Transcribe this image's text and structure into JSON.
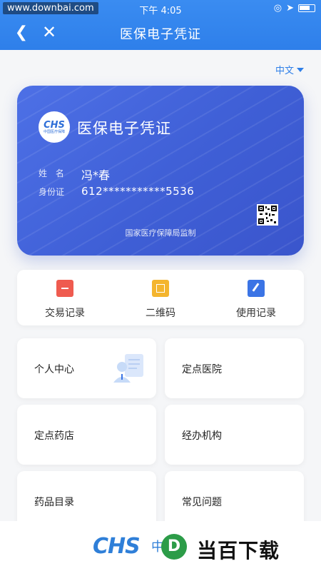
{
  "status_bar": {
    "watermark": "www.downbai.com",
    "time": "下午 4:05"
  },
  "nav": {
    "title": "医保电子凭证",
    "back_icon": "chevron-left-icon",
    "close_icon": "close-icon"
  },
  "language": {
    "selected": "中文"
  },
  "card": {
    "logo_text": "CHS",
    "logo_sub": "中国医疗保障",
    "title": "医保电子凭证",
    "name_label": "姓 名",
    "name_value": "冯*春",
    "id_label": "身份证",
    "id_value": "612***********5536",
    "supervisor": "国家医疗保障局监制"
  },
  "actions": [
    {
      "label": "交易记录",
      "icon": "document-icon",
      "color": "#ef5b4f"
    },
    {
      "label": "二维码",
      "icon": "qrcode-icon",
      "color": "#f4b52e"
    },
    {
      "label": "使用记录",
      "icon": "edit-icon",
      "color": "#3b74e5"
    }
  ],
  "tiles": [
    {
      "label": "个人中心"
    },
    {
      "label": "定点医院"
    },
    {
      "label": "定点药店"
    },
    {
      "label": "经办机构"
    },
    {
      "label": "药品目录"
    },
    {
      "label": "常见问题"
    }
  ],
  "footer": {
    "logo": "CHS",
    "logo_cn": "中",
    "badge_letter": "D",
    "brand": "当百下载"
  },
  "colors": {
    "header": "#2e7fea",
    "card": "#4463db",
    "accent": "#2f7fe8"
  }
}
